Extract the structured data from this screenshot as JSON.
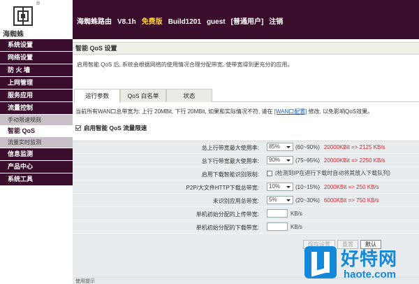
{
  "logo": {
    "text": "海蜘蛛",
    "reg": "®"
  },
  "topbar": {
    "product": "海蜘蛛路由",
    "version": "V8.1h",
    "edition": "免费版",
    "build": "Build1201",
    "user": "guest",
    "role": "[普通用户]",
    "logout": "注销"
  },
  "sidebar": {
    "items": [
      {
        "label": "系统设置"
      },
      {
        "label": "网络设置"
      },
      {
        "label": "防 火 墙"
      },
      {
        "label": "上网管理"
      },
      {
        "label": "服务应用"
      },
      {
        "label": "流量控制"
      }
    ],
    "subitems": [
      {
        "label": "手动限速规则"
      },
      {
        "label": "智能 QoS"
      },
      {
        "label": "流量实时监测"
      }
    ],
    "items2": [
      {
        "label": "信息监测"
      },
      {
        "label": "产品中心"
      },
      {
        "label": "系统工具"
      }
    ]
  },
  "main": {
    "title": "智能 QoS 设置",
    "description": "启用智能 QoS 后, 系统会根据网络的使用情况合理分配带宽, 使带宽得到更充分的应用。",
    "tabs": [
      {
        "label": "运行参数"
      },
      {
        "label": "QoS 白名单"
      },
      {
        "label": "状态"
      }
    ],
    "info_prefix": "当前所有WAN口总带宽为: 上行 20MBit, 下行 20MBit, 如果和实际情况不符, 请在",
    "info_link": "[WAN口配置]",
    "info_suffix": "修改, 以免影响QoS效果。",
    "enable_label": "启用智能 QoS 流量限速",
    "rows": {
      "upload": {
        "label": "总上行带宽最大使用率:",
        "value": "85%",
        "range": "(60~90%)",
        "calc": "20000KBit => 2125 KB/s"
      },
      "download": {
        "label": "总下行带宽最大使用率:",
        "value": "90%",
        "range": "(75~95%)",
        "calc": "20000KBit => 2250 KB/s"
      },
      "smart_detect": {
        "label": "启用下载智能识别限制:",
        "note": "(检测到IP在进行下载时自动将其放入下载队列)"
      },
      "p2p": {
        "label": "P2P/大文件HTTP下载总带宽:",
        "value": "10%",
        "range": "(10~15%)",
        "calc": "2000KBit => 250 KB/s"
      },
      "unknown": {
        "label": "未识别应用总带宽:",
        "value": "5%",
        "range": "(20~30%)",
        "calc": "6000KBit => 750 KB/s"
      },
      "init_up": {
        "label": "单机初始分配的上传带宽:",
        "unit": "KB/s"
      },
      "init_down": {
        "label": "单机初始分配的下载带宽:",
        "unit": "KB/s"
      }
    },
    "buttons": {
      "save": "保存设置",
      "reset": "重置",
      "default": "默认"
    },
    "tips": "使用提示"
  },
  "watermark": {
    "cn": "好特网",
    "en": "haote.com"
  },
  "colors": {
    "accent": "#3a0d2c",
    "highlight": "#ffd33a",
    "calc": "#d2262a",
    "link": "#1a5fb4",
    "watermark": "#1488d8"
  }
}
